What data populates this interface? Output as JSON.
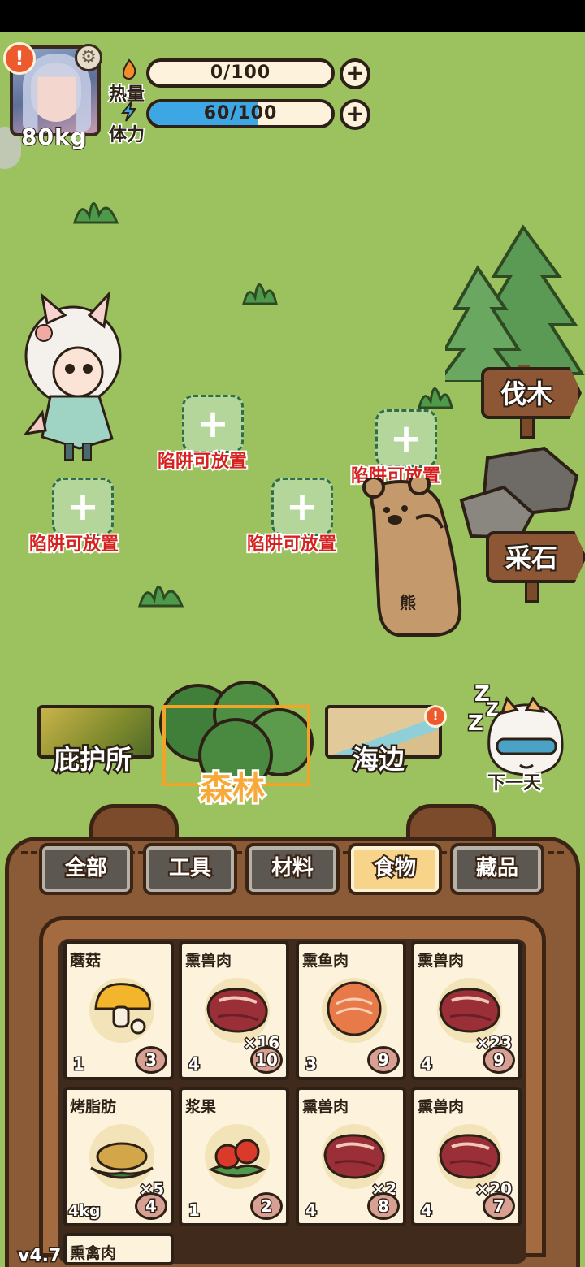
{
  "player": {
    "weight": "80kg",
    "alert_badge": "!",
    "settings_icon": "gear-icon"
  },
  "stats": {
    "heat": {
      "label": "热量",
      "text": "0/100",
      "value": 0,
      "max": 100,
      "icon": "flame-icon"
    },
    "stamina": {
      "label": "体力",
      "text": "60/100",
      "value": 60,
      "max": 100,
      "icon": "lightning-icon"
    }
  },
  "map": {
    "traps": [
      {
        "label": "陷阱可放置"
      },
      {
        "label": "陷阱可放置"
      },
      {
        "label": "陷阱可放置"
      },
      {
        "label": "陷阱可放置"
      }
    ],
    "signs": {
      "chop": "伐木",
      "mine": "采石"
    },
    "bear_label": "熊"
  },
  "locations": {
    "shelter": "庇护所",
    "forest": "森林",
    "seaside": "海边",
    "seaside_badge": "!",
    "next_day": "下一天",
    "zzz": "Z"
  },
  "inventory": {
    "tabs": [
      "全部",
      "工具",
      "材料",
      "食物",
      "藏品"
    ],
    "active_tab": "食物",
    "items": [
      {
        "name": "蘑菇",
        "count": "",
        "weight": "",
        "value": "1",
        "price": "3",
        "art": "mushroom"
      },
      {
        "name": "熏兽肉",
        "count": "×16",
        "weight": "",
        "value": "4",
        "price": "10",
        "art": "meat"
      },
      {
        "name": "熏鱼肉",
        "count": "",
        "weight": "",
        "value": "3",
        "price": "9",
        "art": "fish"
      },
      {
        "name": "熏兽肉",
        "count": "×23",
        "weight": "",
        "value": "4",
        "price": "9",
        "art": "meat"
      },
      {
        "name": "烤脂肪",
        "count": "×5",
        "weight": "4kg",
        "value": "",
        "price": "4",
        "art": "fat"
      },
      {
        "name": "浆果",
        "count": "",
        "weight": "",
        "value": "1",
        "price": "2",
        "art": "berry"
      },
      {
        "name": "熏兽肉",
        "count": "×2",
        "weight": "",
        "value": "4",
        "price": "8",
        "art": "meat"
      },
      {
        "name": "熏兽肉",
        "count": "×20",
        "weight": "",
        "value": "4",
        "price": "7",
        "art": "meat"
      },
      {
        "name": "熏禽肉",
        "count": "",
        "weight": "",
        "value": "",
        "price": "",
        "art": "meat"
      }
    ]
  },
  "version": "v4.7",
  "colors": {
    "grass": "#9bc25e",
    "stamina_fill": "#3da7e6",
    "trap_label": "#d6211f",
    "wood": "#8b5a36",
    "active_tab": "#f8d48a",
    "forest_label": "#f8a93a"
  }
}
